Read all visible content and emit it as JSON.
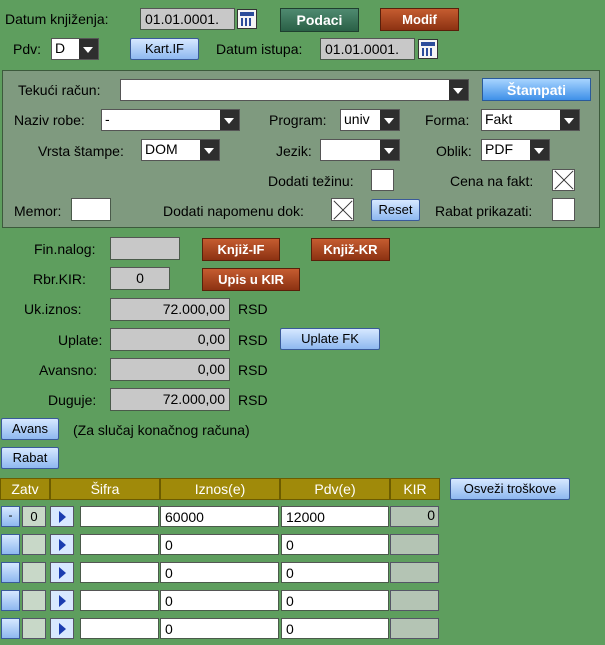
{
  "top": {
    "datum_knjizenja_label": "Datum knjiženja:",
    "datum_knjizenja_value": "01.01.0001.",
    "podaci_label": "Podaci",
    "modif_label": "Modif",
    "pdv_label": "Pdv:",
    "pdv_value": "D",
    "kartif_label": "Kart.IF",
    "datum_istupa_label": "Datum istupa:",
    "datum_istupa_value": "01.01.0001."
  },
  "panel": {
    "tekuci_racun_label": "Tekući račun:",
    "tekuci_racun_value": "",
    "stampati_label": "Štampati",
    "naziv_robe_label": "Naziv robe:",
    "naziv_robe_value": "-",
    "program_label": "Program:",
    "program_value": "univ",
    "forma_label": "Forma:",
    "forma_value": "Fakt",
    "vrsta_stampe_label": "Vrsta štampe:",
    "vrsta_stampe_value": "DOM",
    "jezik_label": "Jezik:",
    "jezik_value": "",
    "oblik_label": "Oblik:",
    "oblik_value": "PDF",
    "dodati_tezinu_label": "Dodati težinu:",
    "cena_na_fakt_label": "Cena na fakt:",
    "memor_label": "Memor:",
    "memor_value": "",
    "dodati_napomenu_label": "Dodati napomenu dok:",
    "reset_label": "Reset",
    "rabat_prikazati_label": "Rabat prikazati:"
  },
  "finance": {
    "fin_nalog_label": "Fin.nalog:",
    "fin_nalog_value": "",
    "knjiz_if_label": "Knjiž-IF",
    "knjiz_kr_label": "Knjiž-KR",
    "rbr_kir_label": "Rbr.KIR:",
    "rbr_kir_value": "0",
    "upis_kir_label": "Upis u KIR",
    "uk_iznos_label": "Uk.iznos:",
    "uk_iznos_value": "72.000,00",
    "uplate_label": "Uplate:",
    "uplate_value": "0,00",
    "uplate_fk_label": "Uplate FK",
    "avansno_label": "Avansno:",
    "avansno_value": "0,00",
    "duguje_label": "Duguje:",
    "duguje_value": "72.000,00",
    "currency": "RSD",
    "avans_label": "Avans",
    "avans_note": "(Za slučaj konačnog računa)",
    "rabat_label": "Rabat"
  },
  "grid": {
    "headers": {
      "zatv": "Zatv",
      "sifra": "Šifra",
      "iznos": "Iznos(e)",
      "pdv": "Pdv(e)",
      "kir": "KIR"
    },
    "osvezi_label": "Osveži troškove",
    "minus_label": "-",
    "rows": [
      {
        "zatv": "0",
        "sifra": "",
        "iznos": "60000",
        "pdv": "12000",
        "kir": "0"
      },
      {
        "zatv": "",
        "sifra": "",
        "iznos": "0",
        "pdv": "0",
        "kir": ""
      },
      {
        "zatv": "",
        "sifra": "",
        "iznos": "0",
        "pdv": "0",
        "kir": ""
      },
      {
        "zatv": "",
        "sifra": "",
        "iznos": "0",
        "pdv": "0",
        "kir": ""
      },
      {
        "zatv": "",
        "sifra": "",
        "iznos": "0",
        "pdv": "0",
        "kir": ""
      }
    ]
  }
}
